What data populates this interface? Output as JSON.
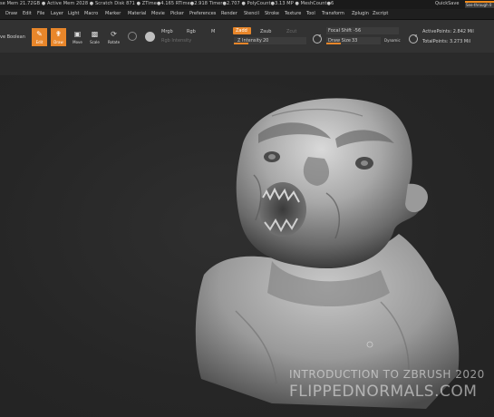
{
  "titlebar": {
    "stats": "se Mem 21.72GB ● Active Mem 2028 ● Scratch Disk 871 ● ZTime●4.165 RTime●2.918 Timer●2.707 ● PolyCount●3.13 MP ● MeshCount●6",
    "quicksave": "QuickSave",
    "seethrough": "See-through 0"
  },
  "menu": [
    "Draw",
    "Edit",
    "File",
    "Layer",
    "Light",
    "Macro",
    "Marker",
    "Material",
    "Movie",
    "Picker",
    "Preferences",
    "Render",
    "Stencil",
    "Stroke",
    "Texture",
    "Tool",
    "Transform",
    "Zplugin",
    "Zscript"
  ],
  "toolbar": {
    "live_boolean": "ve Boolean",
    "buttons": [
      {
        "label": "Edit",
        "icon": "edit-icon"
      },
      {
        "label": "Draw",
        "icon": "draw-icon"
      },
      {
        "label": "Move",
        "icon": "move-icon"
      },
      {
        "label": "Scale",
        "icon": "scale-icon"
      },
      {
        "label": "Rotate",
        "icon": "rotate-icon"
      }
    ],
    "mrgb": "Mrgb",
    "rgb": "Rgb",
    "m": "M",
    "rgb_intensity": "Rgb Intensity",
    "zadd": "Zadd",
    "zsub": "Zsub",
    "zcut": "Zcut",
    "z_intensity": "Z Intensity",
    "z_intensity_value": "20",
    "z_intensity_fraction": 0.2,
    "focal_shift": "Focal Shift",
    "focal_shift_value": "-56",
    "draw_size": "Draw Size",
    "draw_size_value": "33",
    "dynamic": "Dynamic",
    "active_points": "ActivePoints: 2.842 Mil",
    "total_points": "TotalPoints: 3.273 Mil"
  },
  "watermark": {
    "line1": "INTRODUCTION TO ZBRUSH 2020",
    "line2": "FLIPPEDNORMALS.COM"
  },
  "colors": {
    "accent": "#e8862a",
    "background": "#262626"
  }
}
